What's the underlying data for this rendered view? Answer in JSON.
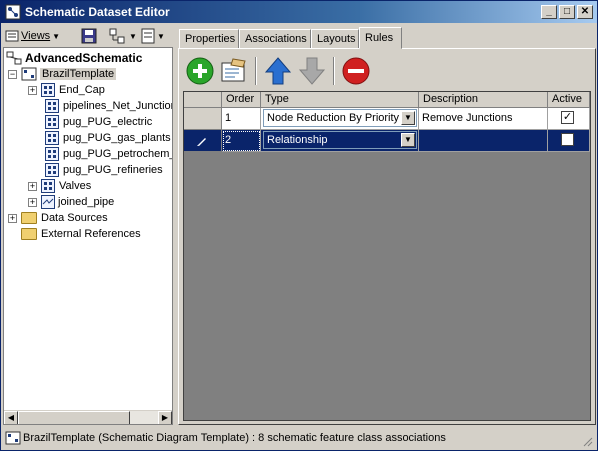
{
  "window": {
    "title": "Schematic Dataset Editor",
    "min": "_",
    "max": "□",
    "close": "✕"
  },
  "toolbar": {
    "views_label": "Views"
  },
  "tree": {
    "root": "AdvancedSchematic",
    "template": "BrazilTemplate",
    "items": [
      {
        "label": "End_Cap",
        "expander": "+"
      },
      {
        "label": "pipelines_Net_Junctions",
        "expander": ""
      },
      {
        "label": "pug_PUG_electric",
        "expander": ""
      },
      {
        "label": "pug_PUG_gas_plants",
        "expander": ""
      },
      {
        "label": "pug_PUG_petrochem_",
        "expander": ""
      },
      {
        "label": "pug_PUG_refineries",
        "expander": ""
      },
      {
        "label": "Valves",
        "expander": "+"
      },
      {
        "label": "joined_pipe",
        "expander": "+"
      }
    ],
    "folders": [
      "Data Sources",
      "External References"
    ]
  },
  "tabs": [
    "Properties",
    "Associations",
    "Layouts",
    "Rules"
  ],
  "active_tab": "Rules",
  "rules": {
    "columns": [
      "Order",
      "Type",
      "Description",
      "Active"
    ],
    "rows": [
      {
        "order": "1",
        "type": "Node Reduction By Priority",
        "description": "Remove Junctions",
        "active": true,
        "selected": false
      },
      {
        "order": "2",
        "type": "Relationship",
        "description": "",
        "active": false,
        "selected": true
      }
    ],
    "buttons": {
      "add": "add-rule",
      "properties": "rule-properties",
      "up": "move-up",
      "down": "move-down",
      "remove": "remove-rule"
    }
  },
  "status": {
    "text": "BrazilTemplate (Schematic Diagram Template) : 8 schematic feature class associations"
  },
  "colors": {
    "title_start": "#0a246a",
    "title_end": "#a6caf0",
    "selection": "#0a246a",
    "add_green": "#2aa52a",
    "remove_red": "#d02020",
    "arrow_blue": "#2a6fd0"
  }
}
